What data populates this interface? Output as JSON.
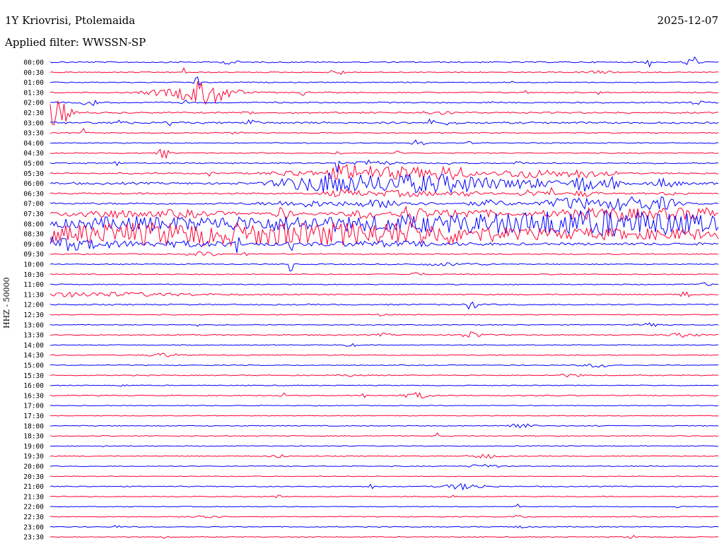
{
  "header": {
    "station": "1Y Kriovrisi, Ptolemaida",
    "date": "2025-12-07",
    "filter": "Applied filter: WWSSN-SP"
  },
  "chart_data": {
    "type": "line",
    "ylabel": "HHZ - 50000",
    "row_labels": [
      "00:00",
      "00:30",
      "01:00",
      "01:30",
      "02:00",
      "02:30",
      "03:00",
      "03:30",
      "04:00",
      "04:30",
      "05:00",
      "05:30",
      "06:00",
      "06:30",
      "07:00",
      "07:30",
      "08:00",
      "08:30",
      "09:00",
      "09:30",
      "10:00",
      "10:30",
      "11:00",
      "11:30",
      "12:00",
      "12:30",
      "13:00",
      "13:30",
      "14:00",
      "14:30",
      "15:00",
      "15:30",
      "16:00",
      "16:30",
      "17:00",
      "17:30",
      "18:00",
      "18:30",
      "19:00",
      "19:30",
      "20:00",
      "20:30",
      "21:00",
      "21:30",
      "22:00",
      "22:30",
      "23:00",
      "23:30"
    ],
    "colors": [
      "#0000ff",
      "#ff0033"
    ],
    "rows": [
      {
        "noise": 1.0,
        "events": [
          [
            0.27,
            4,
            0.01
          ],
          [
            0.895,
            8,
            0.004
          ],
          [
            0.96,
            12,
            0.008
          ]
        ]
      },
      {
        "noise": 0.8,
        "events": [
          [
            0.2,
            6,
            0.002
          ],
          [
            0.43,
            5,
            0.01
          ],
          [
            0.82,
            2,
            0.02
          ]
        ]
      },
      {
        "noise": 0.8,
        "events": [
          [
            0.22,
            10,
            0.004
          ],
          [
            0.69,
            3,
            0.003
          ]
        ]
      },
      {
        "noise": 0.9,
        "events": [
          [
            0.16,
            3,
            0.025
          ],
          [
            0.23,
            18,
            0.04
          ],
          [
            0.38,
            5,
            0.005
          ],
          [
            0.71,
            3,
            0.004
          ],
          [
            0.82,
            8,
            0.003
          ]
        ]
      },
      {
        "noise": 1.0,
        "events": [
          [
            0.06,
            6,
            0.01
          ],
          [
            0.2,
            4,
            0.005
          ],
          [
            0.66,
            4,
            0.003
          ],
          [
            0.97,
            3,
            0.01
          ]
        ]
      },
      {
        "noise": 1.2,
        "events": [
          [
            0.01,
            18,
            0.02
          ],
          [
            0.3,
            2,
            0.01
          ],
          [
            0.58,
            3,
            0.02
          ]
        ]
      },
      {
        "noise": 1.5,
        "events": [
          [
            0.1,
            4,
            0.01
          ],
          [
            0.18,
            10,
            0.003
          ],
          [
            0.3,
            4,
            0.01
          ],
          [
            0.57,
            6,
            0.004
          ],
          [
            0.6,
            3,
            0.01
          ]
        ]
      },
      {
        "noise": 0.8,
        "events": [
          [
            0.05,
            6,
            0.005
          ],
          [
            0.28,
            2,
            0.01
          ]
        ]
      },
      {
        "noise": 0.8,
        "events": [
          [
            0.55,
            4,
            0.01
          ],
          [
            0.63,
            3,
            0.005
          ]
        ]
      },
      {
        "noise": 0.8,
        "events": [
          [
            0.17,
            8,
            0.008
          ],
          [
            0.43,
            5,
            0.005
          ],
          [
            0.52,
            3,
            0.005
          ]
        ]
      },
      {
        "noise": 1.0,
        "events": [
          [
            0.1,
            4,
            0.004
          ],
          [
            0.43,
            14,
            0.003
          ],
          [
            0.48,
            4,
            0.03
          ],
          [
            0.6,
            3,
            0.005
          ],
          [
            0.7,
            4,
            0.005
          ]
        ]
      },
      {
        "noise": 1.2,
        "events": [
          [
            0.24,
            5,
            0.003
          ],
          [
            0.36,
            4,
            0.03
          ],
          [
            0.45,
            12,
            0.04
          ],
          [
            0.53,
            8,
            0.05
          ],
          [
            0.6,
            10,
            0.03
          ],
          [
            0.7,
            5,
            0.03
          ],
          [
            0.75,
            4,
            0.05
          ],
          [
            0.8,
            5,
            0.02
          ],
          [
            0.84,
            3,
            0.01
          ]
        ]
      },
      {
        "noise": 1.8,
        "events": [
          [
            0.36,
            6,
            0.03
          ],
          [
            0.42,
            14,
            0.04
          ],
          [
            0.49,
            8,
            0.05
          ],
          [
            0.56,
            10,
            0.06
          ],
          [
            0.63,
            8,
            0.05
          ],
          [
            0.72,
            6,
            0.04
          ],
          [
            0.8,
            12,
            0.02
          ],
          [
            0.84,
            8,
            0.01
          ],
          [
            0.92,
            6,
            0.02
          ]
        ]
      },
      {
        "noise": 1.2,
        "events": [
          [
            0.44,
            5,
            0.03
          ],
          [
            0.53,
            4,
            0.05
          ],
          [
            0.62,
            3,
            0.03
          ],
          [
            0.72,
            5,
            0.02
          ],
          [
            0.75,
            8,
            0.004
          ],
          [
            0.8,
            4,
            0.02
          ],
          [
            0.93,
            2,
            0.02
          ]
        ]
      },
      {
        "noise": 1.5,
        "events": [
          [
            0.38,
            4,
            0.05
          ],
          [
            0.5,
            5,
            0.05
          ],
          [
            0.66,
            4,
            0.03
          ],
          [
            0.78,
            8,
            0.04
          ],
          [
            0.87,
            10,
            0.04
          ],
          [
            0.92,
            6,
            0.02
          ]
        ]
      },
      {
        "noise": 2.5,
        "events": [
          [
            0.08,
            5,
            0.05
          ],
          [
            0.2,
            4,
            0.05
          ],
          [
            0.35,
            10,
            0.01
          ],
          [
            0.47,
            6,
            0.02
          ],
          [
            0.54,
            12,
            0.02
          ],
          [
            0.62,
            5,
            0.05
          ],
          [
            0.78,
            5,
            0.05
          ],
          [
            0.85,
            6,
            0.04
          ],
          [
            0.93,
            6,
            0.05
          ],
          [
            0.98,
            5,
            0.03
          ]
        ]
      },
      {
        "noise": 3.5,
        "events": [
          [
            0.1,
            5,
            0.1
          ],
          [
            0.25,
            6,
            0.15
          ],
          [
            0.4,
            5,
            0.12
          ],
          [
            0.55,
            4,
            0.1
          ],
          [
            0.7,
            8,
            0.2
          ],
          [
            0.82,
            10,
            0.15
          ],
          [
            0.95,
            6,
            0.1
          ]
        ]
      },
      {
        "noise": 4.5,
        "events": [
          [
            0.05,
            6,
            0.15
          ],
          [
            0.2,
            7,
            0.2
          ],
          [
            0.35,
            6,
            0.2
          ],
          [
            0.5,
            7,
            0.15
          ],
          [
            0.6,
            5,
            0.1
          ],
          [
            0.8,
            4,
            0.1
          ],
          [
            0.95,
            4,
            0.1
          ]
        ]
      },
      {
        "noise": 2.0,
        "events": [
          [
            0.01,
            6,
            0.03
          ],
          [
            0.05,
            5,
            0.06
          ],
          [
            0.2,
            3,
            0.1
          ],
          [
            0.28,
            14,
            0.003
          ],
          [
            0.36,
            10,
            0.003
          ],
          [
            0.5,
            3,
            0.1
          ]
        ]
      },
      {
        "noise": 0.9,
        "events": [
          [
            0.23,
            3,
            0.02
          ],
          [
            0.29,
            14,
            0.003
          ]
        ]
      },
      {
        "noise": 0.8,
        "events": [
          [
            0.36,
            24,
            0.002
          ],
          [
            0.6,
            2,
            0.05
          ]
        ]
      },
      {
        "noise": 0.8,
        "events": [
          [
            0.55,
            3,
            0.01
          ]
        ]
      },
      {
        "noise": 0.8,
        "events": [
          [
            0.98,
            2,
            0.01
          ]
        ]
      },
      {
        "noise": 0.9,
        "events": [
          [
            0.05,
            3,
            0.16
          ],
          [
            0.95,
            4,
            0.01
          ]
        ]
      },
      {
        "noise": 1.0,
        "events": [
          [
            0.63,
            6,
            0.01
          ]
        ]
      },
      {
        "noise": 0.7,
        "events": [
          [
            0.5,
            2,
            0.01
          ]
        ]
      },
      {
        "noise": 0.7,
        "events": [
          [
            0.22,
            2,
            0.002
          ],
          [
            0.9,
            2,
            0.02
          ]
        ]
      },
      {
        "noise": 0.9,
        "events": [
          [
            0.5,
            2,
            0.01
          ],
          [
            0.63,
            4,
            0.02
          ],
          [
            0.95,
            3,
            0.02
          ]
        ]
      },
      {
        "noise": 0.7,
        "events": [
          [
            0.45,
            2,
            0.01
          ]
        ]
      },
      {
        "noise": 0.8,
        "events": [
          [
            0.17,
            3,
            0.02
          ]
        ]
      },
      {
        "noise": 0.7,
        "events": [
          [
            0.82,
            3,
            0.02
          ]
        ]
      },
      {
        "noise": 0.8,
        "events": [
          [
            0.45,
            2,
            0.01
          ],
          [
            0.78,
            2,
            0.02
          ]
        ]
      },
      {
        "noise": 0.7,
        "events": [
          [
            0.11,
            3,
            0.005
          ]
        ]
      },
      {
        "noise": 0.8,
        "events": [
          [
            0.35,
            3,
            0.005
          ],
          [
            0.47,
            4,
            0.003
          ],
          [
            0.55,
            4,
            0.02
          ]
        ]
      },
      {
        "noise": 0.6,
        "events": []
      },
      {
        "noise": 0.6,
        "events": []
      },
      {
        "noise": 0.7,
        "events": [
          [
            0.7,
            4,
            0.02
          ],
          [
            0.82,
            2,
            0.005
          ]
        ]
      },
      {
        "noise": 0.7,
        "events": [
          [
            0.58,
            4,
            0.003
          ]
        ]
      },
      {
        "noise": 0.7,
        "events": [
          [
            0.08,
            2,
            0.005
          ]
        ]
      },
      {
        "noise": 0.7,
        "events": [
          [
            0.34,
            3,
            0.01
          ],
          [
            0.65,
            3,
            0.02
          ]
        ]
      },
      {
        "noise": 0.7,
        "events": [
          [
            0.65,
            3,
            0.02
          ]
        ]
      },
      {
        "noise": 0.6,
        "events": []
      },
      {
        "noise": 0.8,
        "events": [
          [
            0.48,
            4,
            0.004
          ],
          [
            0.62,
            4,
            0.03
          ]
        ]
      },
      {
        "noise": 0.7,
        "events": [
          [
            0.34,
            3,
            0.005
          ],
          [
            0.6,
            2,
            0.005
          ]
        ]
      },
      {
        "noise": 0.6,
        "events": [
          [
            0.7,
            3,
            0.004
          ],
          [
            0.94,
            2,
            0.004
          ]
        ]
      },
      {
        "noise": 0.7,
        "events": [
          [
            0.23,
            3,
            0.02
          ],
          [
            0.7,
            2,
            0.01
          ]
        ]
      },
      {
        "noise": 0.7,
        "events": [
          [
            0.1,
            6,
            0.003
          ],
          [
            0.7,
            2,
            0.01
          ]
        ]
      },
      {
        "noise": 0.7,
        "events": [
          [
            0.17,
            2,
            0.005
          ],
          [
            0.87,
            2,
            0.01
          ]
        ]
      }
    ]
  }
}
